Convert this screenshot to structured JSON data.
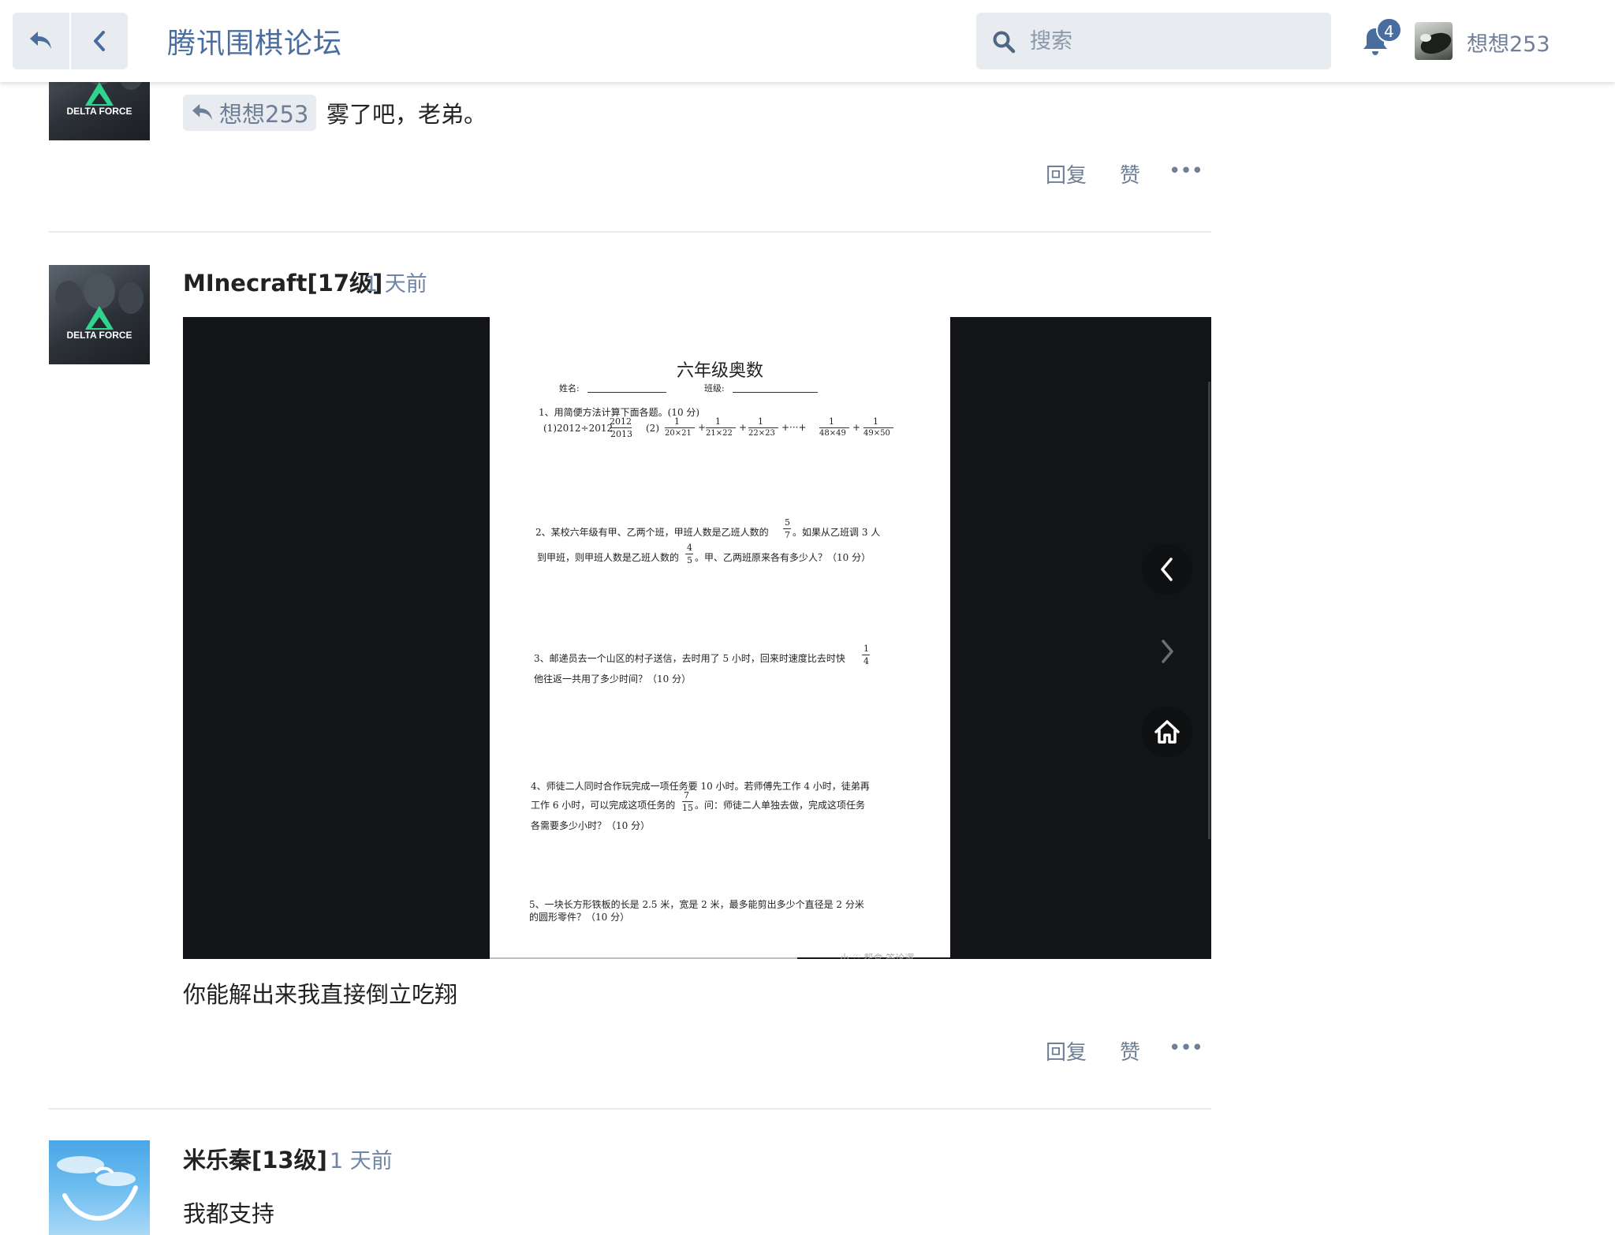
{
  "header": {
    "forum_title": "腾讯围棋论坛",
    "search_placeholder": "搜索",
    "notification_count": "4",
    "user_name": "想想253"
  },
  "posts": [
    {
      "reply_to": "想想253",
      "text": "雾了吧，老弟。",
      "actions": {
        "reply": "回复",
        "like": "赞",
        "more": "•••"
      }
    },
    {
      "author": "MInecraft[17级]",
      "time": "1 天前",
      "image": {
        "title": "六年级奥数",
        "name_label": "姓名:",
        "class_label": "班级:",
        "q1": "1、用简便方法计算下面各题。(10 分)",
        "q1_a": "(1)2012÷2012",
        "q1_a_num": "2012",
        "q1_a_den": "2013",
        "q1_b": "(2)",
        "q1_b_terms": [
          {
            "num": "1",
            "den": "20×21"
          },
          {
            "num": "1",
            "den": "21×22"
          },
          {
            "num": "1",
            "den": "22×23"
          },
          {
            "num": "1",
            "den": "48×49"
          },
          {
            "num": "1",
            "den": "49×50"
          }
        ],
        "q2_line1": "2、某校六年级有甲、乙两个班，甲班人数是乙班人数的",
        "q2_frac1_num": "5",
        "q2_frac1_den": "7",
        "q2_line1_end": "。如果从乙班调 3 人",
        "q2_line2": "到甲班，则甲班人数是乙班人数的",
        "q2_frac2_num": "4",
        "q2_frac2_den": "5",
        "q2_line2_end": "。甲、乙两班原来各有多少人？（10 分）",
        "q3_line1": "3、邮递员去一个山区的村子送信，去时用了 5 小时，回来时速度比去时快",
        "q3_frac_num": "1",
        "q3_frac_den": "4",
        "q3_line2": "他往返一共用了多少时间？（10 分）",
        "q4_line1": "4、师徒二人同时合作玩完成一项任务要 10 小时。若师傅先工作 4 小时，徒弟再",
        "q4_line2": "工作 6 小时，可以完成这项任务的",
        "q4_frac_num": "7",
        "q4_frac_den": "15",
        "q4_line2_end": "。问：师徒二人单独去做，完成这项任务",
        "q4_line3": "各需要多少小时？（10 分）",
        "q5_line1": "5、一块长方形铁板的长是 2.5 米，宽是 2 米，最多能剪出多少个直径是 2 分米",
        "q5_line2": "的圆形零件？（10 分）",
        "watermark": "小 ♡ 帮盒 答论逻"
      },
      "text": "你能解出来我直接倒立吃翔",
      "actions": {
        "reply": "回复",
        "like": "赞",
        "more": "•••"
      }
    },
    {
      "author": "米乐秦[13级]",
      "time": "1 天前",
      "text": "我都支持"
    }
  ],
  "colors": {
    "accent": "#4a6da0",
    "header_button_bg": "#e8ecf1",
    "muted_text": "#6f7f95",
    "viewer_bg": "#131417"
  },
  "icons": [
    "undo-icon",
    "chevron-left-icon",
    "search-icon",
    "bell-icon",
    "reply-arrow-icon",
    "viewer-prev-icon",
    "viewer-next-icon",
    "home-icon"
  ]
}
